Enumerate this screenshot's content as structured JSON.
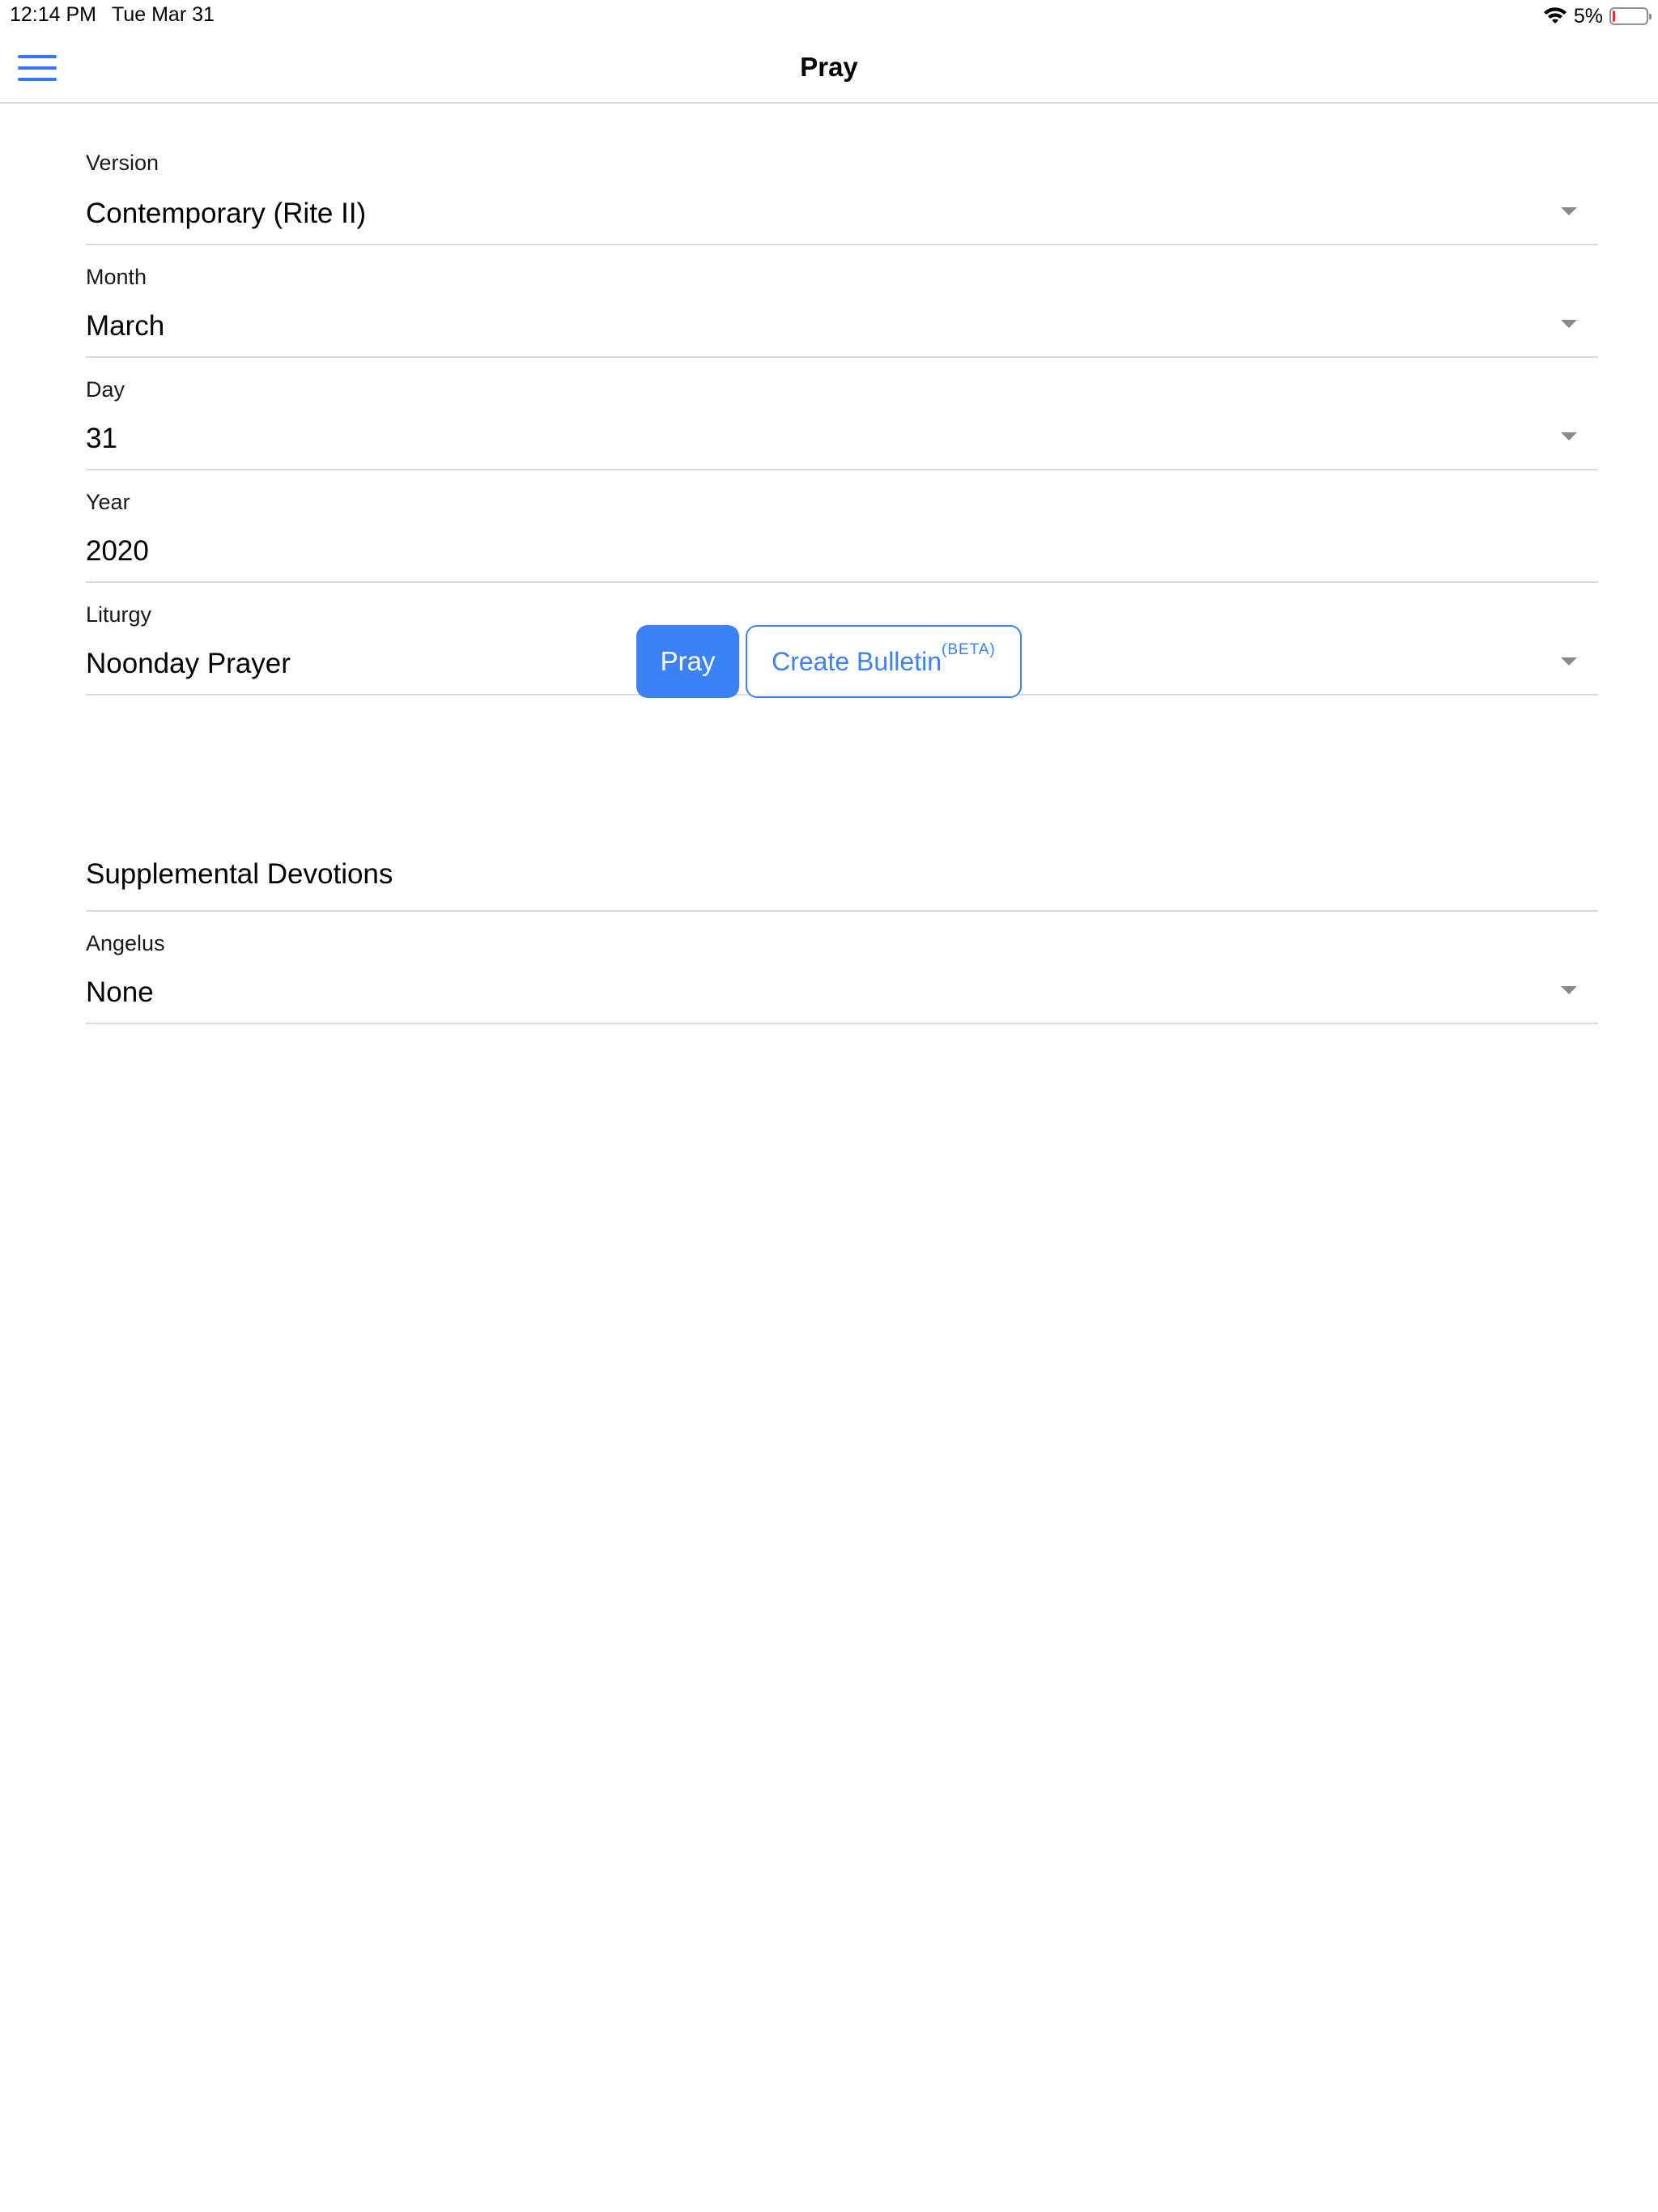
{
  "status_bar": {
    "time": "12:14 PM",
    "date": "Tue Mar 31",
    "battery_percent": "5%",
    "battery_level": 0.05,
    "icons": [
      "wifi-icon",
      "battery-icon"
    ]
  },
  "navbar": {
    "title": "Pray",
    "menu_icon": "hamburger-menu-icon"
  },
  "form": {
    "fields": [
      {
        "label": "Version",
        "value": "Contemporary (Rite II)",
        "type": "select"
      },
      {
        "label": "Month",
        "value": "March",
        "type": "select"
      },
      {
        "label": "Day",
        "value": "31",
        "type": "select"
      },
      {
        "label": "Year",
        "value": "2020",
        "type": "input"
      },
      {
        "label": "Liturgy",
        "value": "Noonday Prayer",
        "type": "select"
      }
    ]
  },
  "buttons": {
    "pray": "Pray",
    "bulletin": "Create Bulletin",
    "bulletin_superscript": "(BETA)"
  },
  "supplemental": {
    "title": "Supplemental Devotions",
    "angelus": {
      "label": "Angelus",
      "value": "None",
      "type": "select"
    }
  },
  "colors": {
    "accent": "#3b82f6",
    "divider": "#dadada",
    "caret": "#8a8a8a",
    "battery_low": "#e0352b"
  }
}
